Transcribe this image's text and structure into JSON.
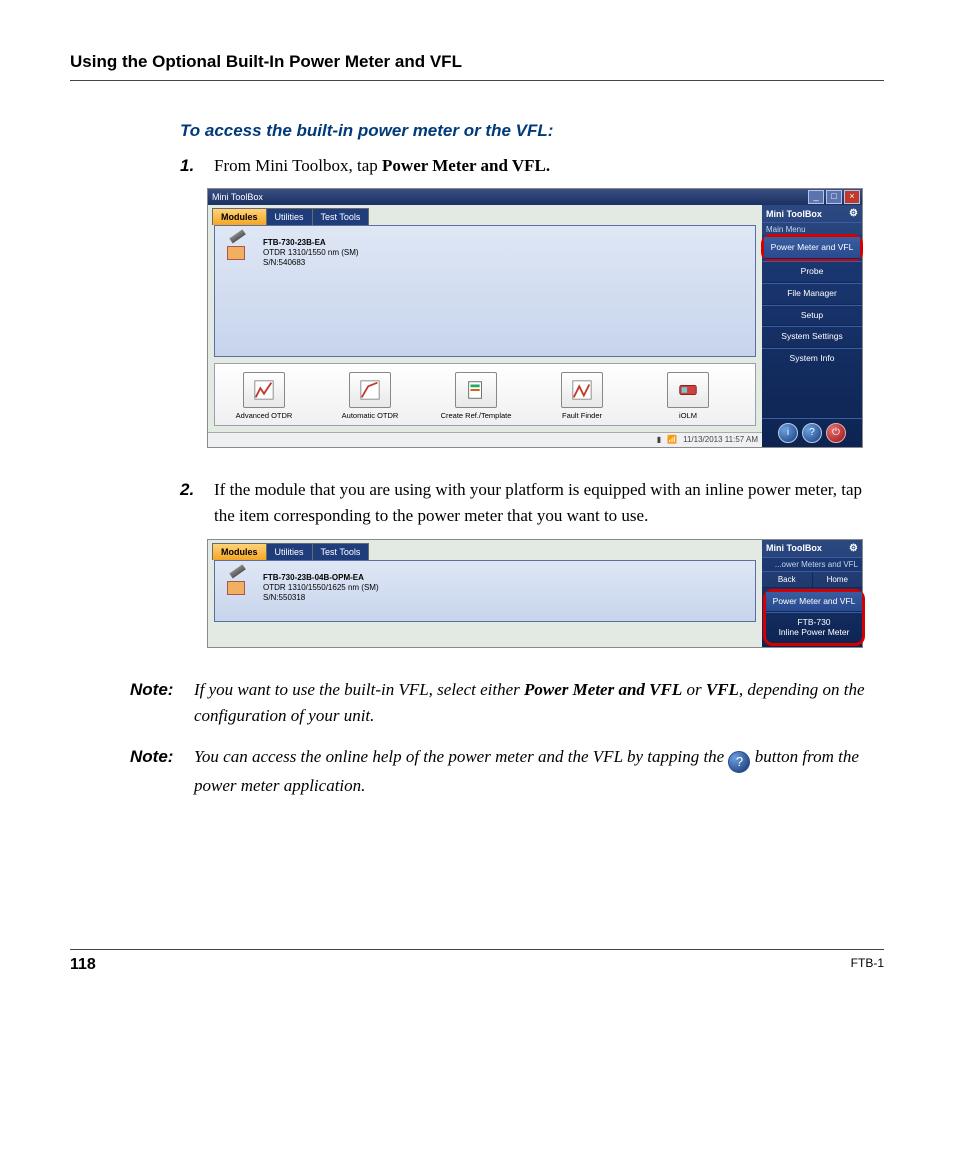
{
  "section_title": "Using the Optional Built-In Power Meter and VFL",
  "subhead": "To access the built-in power meter or the VFL:",
  "steps": {
    "s1": {
      "num": "1.",
      "pre": "From Mini Toolbox, tap ",
      "bold": "Power Meter and VFL."
    },
    "s2": {
      "num": "2.",
      "text": "If the module that you are using with your platform is equipped with an inline power meter, tap the item corresponding to the power meter that you want to use."
    }
  },
  "shot1": {
    "window_title": "Mini ToolBox",
    "tabs": {
      "t0": "Modules",
      "t1": "Utilities",
      "t2": "Test Tools"
    },
    "module": {
      "title": "FTB-730-23B-EA",
      "line2": "OTDR 1310/1550 nm (SM)",
      "line3": "S/N:540683"
    },
    "apps": {
      "a0": "Advanced OTDR",
      "a1": "Automatic OTDR",
      "a2": "Create Ref./Template",
      "a3": "Fault Finder",
      "a4": "iOLM"
    },
    "side": {
      "title": "Mini ToolBox",
      "menu_label": "Main Menu",
      "i0": "Power Meter and VFL",
      "i1": "Probe",
      "i2": "File Manager",
      "i3": "Setup",
      "i4": "System Settings",
      "i5": "System Info"
    },
    "status_time": "11/13/2013  11:57 AM",
    "wnd_min": "_",
    "wnd_max": "□",
    "wnd_close": "×"
  },
  "shot2": {
    "tabs": {
      "t0": "Modules",
      "t1": "Utilities",
      "t2": "Test Tools"
    },
    "module": {
      "title": "FTB-730-23B-04B-OPM-EA",
      "line2": "OTDR 1310/1550/1625 nm (SM)",
      "line3": "S/N:550318"
    },
    "side": {
      "title": "Mini ToolBox",
      "crumb": "...ower Meters and VFL",
      "back": "Back",
      "home": "Home",
      "i0": "Power Meter and VFL",
      "i1a": "FTB-730",
      "i1b": "Inline Power Meter"
    }
  },
  "notes": {
    "label": "Note:",
    "n1_a": "If you want to use the built-in VFL, select either ",
    "n1_b1": "Power Meter and VFL",
    "n1_c": " or ",
    "n1_b2": "VFL",
    "n1_d": ", depending on the configuration of your unit.",
    "n2_a": "You can access the online help of the power meter and the VFL by tapping the ",
    "n2_b": " button from the power meter application.",
    "help_glyph": "?"
  },
  "footer": {
    "page": "118",
    "model": "FTB-1"
  }
}
